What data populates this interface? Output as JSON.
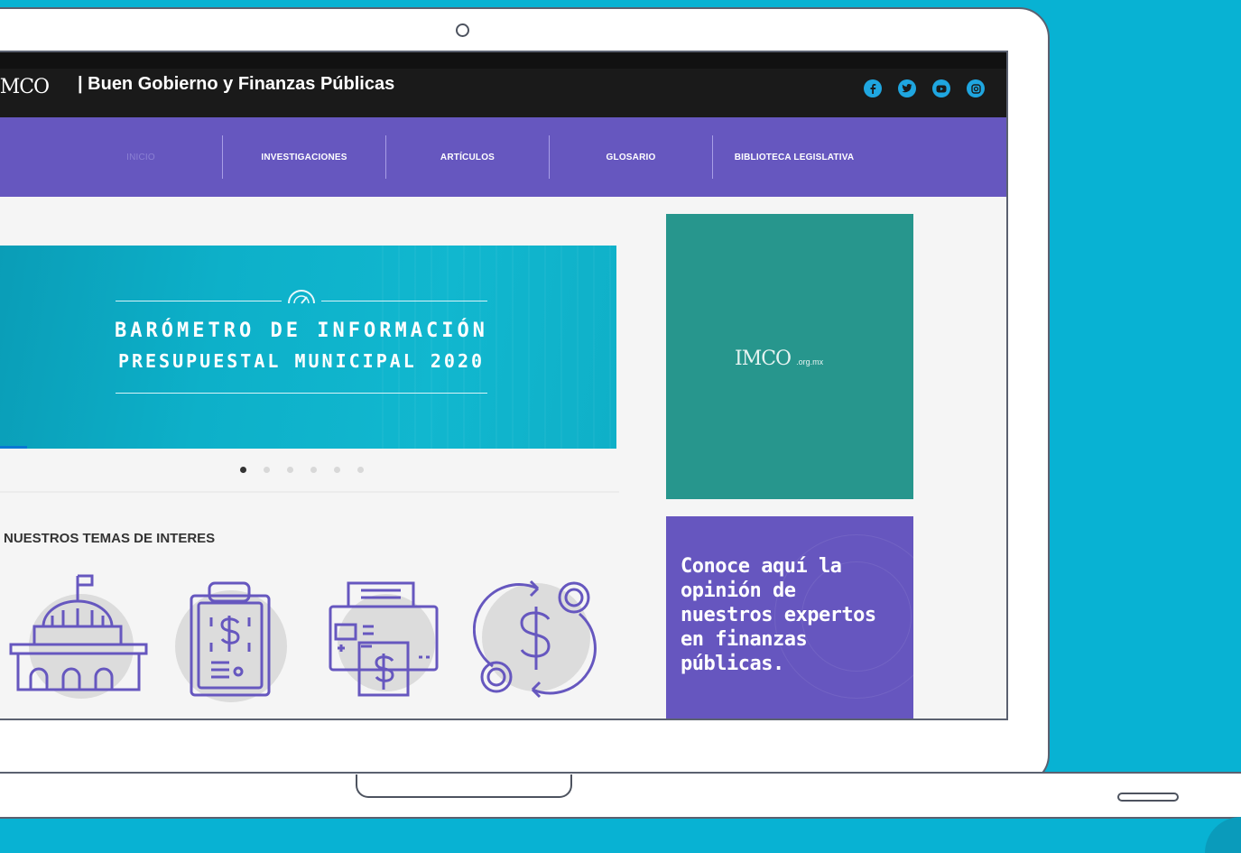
{
  "header": {
    "logo": "IMCO",
    "title": "| Buen Gobierno y Finanzas Públicas",
    "social": [
      "facebook-icon",
      "twitter-icon",
      "youtube-icon",
      "instagram-icon"
    ]
  },
  "nav": {
    "items": [
      {
        "label": "INICIO",
        "active": true
      },
      {
        "label": "INVESTIGACIONES",
        "active": false
      },
      {
        "label": "ARTÍCULOS",
        "active": false
      },
      {
        "label": "GLOSARIO",
        "active": false
      },
      {
        "label": "BIBLIOTECA LEGISLATIVA",
        "active": false
      }
    ]
  },
  "slider": {
    "title_line1": "BARÓMETRO DE INFORMACIÓN",
    "title_line2": "PRESUPUESTAL MUNICIPAL 2020",
    "total_slides": 6,
    "active_slide": 1
  },
  "topics": {
    "section_title": "NUESTROS TEMAS DE INTERES",
    "items": [
      "government-building-icon",
      "budget-clipboard-icon",
      "finance-printer-icon",
      "money-exchange-icon"
    ]
  },
  "sidebar": {
    "ad_logo": "IMCO",
    "ad_logo_suffix": ".org.mx",
    "promo_text": "Conoce aquí la opinión de nuestros expertos en finanzas públicas."
  },
  "colors": {
    "background": "#08b2d3",
    "topbar": "#1a1a1a",
    "nav": "#6657bf",
    "slider": "#0db0c9",
    "ad": "#27968d",
    "promo": "#6656bf",
    "icon_stroke": "#6657bf"
  }
}
